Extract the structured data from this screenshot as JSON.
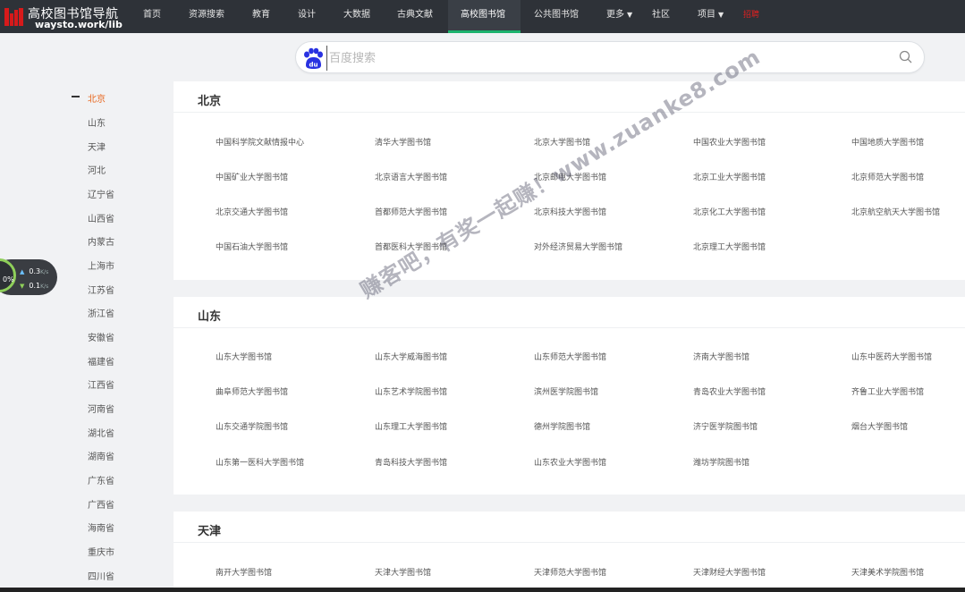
{
  "logo": {
    "title": "高校图书馆导航",
    "subtitle": "waysto.work/lib"
  },
  "nav": {
    "items": [
      "首页",
      "资源搜索",
      "教育",
      "设计",
      "大数据",
      "古典文献",
      "高校图书馆",
      "公共图书馆",
      "更多",
      "社区",
      "项目"
    ],
    "active": "高校图书馆",
    "extra": "招聘"
  },
  "search": {
    "placeholder": "百度搜索"
  },
  "sidebar": {
    "provinces": [
      "北京",
      "山东",
      "天津",
      "河北",
      "辽宁省",
      "山西省",
      "内蒙古",
      "上海市",
      "江苏省",
      "浙江省",
      "安徽省",
      "福建省",
      "江西省",
      "河南省",
      "湖北省",
      "湖南省",
      "广东省",
      "广西省",
      "海南省",
      "重庆市",
      "四川省"
    ],
    "active": "北京"
  },
  "speed_widget": {
    "percent": "0",
    "unit": "%",
    "up": "0.3",
    "down": "0.1",
    "speed_unit": "K/s"
  },
  "sections": [
    {
      "title": "北京",
      "libs": [
        "中国科学院文献情报中心",
        "清华大学图书馆",
        "北京大学图书馆",
        "中国农业大学图书馆",
        "中国地质大学图书馆",
        "中国矿业大学图书馆",
        "北京语言大学图书馆",
        "北京邮电大学图书馆",
        "北京工业大学图书馆",
        "北京师范大学图书馆",
        "北京交通大学图书馆",
        "首都师范大学图书馆",
        "北京科技大学图书馆",
        "北京化工大学图书馆",
        "北京航空航天大学图书馆",
        "中国石油大学图书馆",
        "首都医科大学图书馆",
        "对外经济贸易大学图书馆",
        "北京理工大学图书馆"
      ]
    },
    {
      "title": "山东",
      "libs": [
        "山东大学图书馆",
        "山东大学威海图书馆",
        "山东师范大学图书馆",
        "济南大学图书馆",
        "山东中医药大学图书馆",
        "曲阜师范大学图书馆",
        "山东艺术学院图书馆",
        "滨州医学院图书馆",
        "青岛农业大学图书馆",
        "齐鲁工业大学图书馆",
        "山东交通学院图书馆",
        "山东理工大学图书馆",
        "德州学院图书馆",
        "济宁医学院图书馆",
        "烟台大学图书馆",
        "山东第一医科大学图书馆",
        "青岛科技大学图书馆",
        "山东农业大学图书馆",
        "潍坊学院图书馆"
      ]
    },
    {
      "title": "天津",
      "libs": [
        "南开大学图书馆",
        "天津大学图书馆",
        "天津师范大学图书馆",
        "天津财经大学图书馆",
        "天津美术学院图书馆"
      ]
    }
  ],
  "watermark": "赚客吧，有奖一起赚！www.zuanke8.com",
  "colors": {
    "topbar": "#2e3238",
    "accent_green": "#1db36d",
    "active_orange": "#e8661d",
    "logo_red": "#d71a1b",
    "background": "#f1f2f4"
  }
}
